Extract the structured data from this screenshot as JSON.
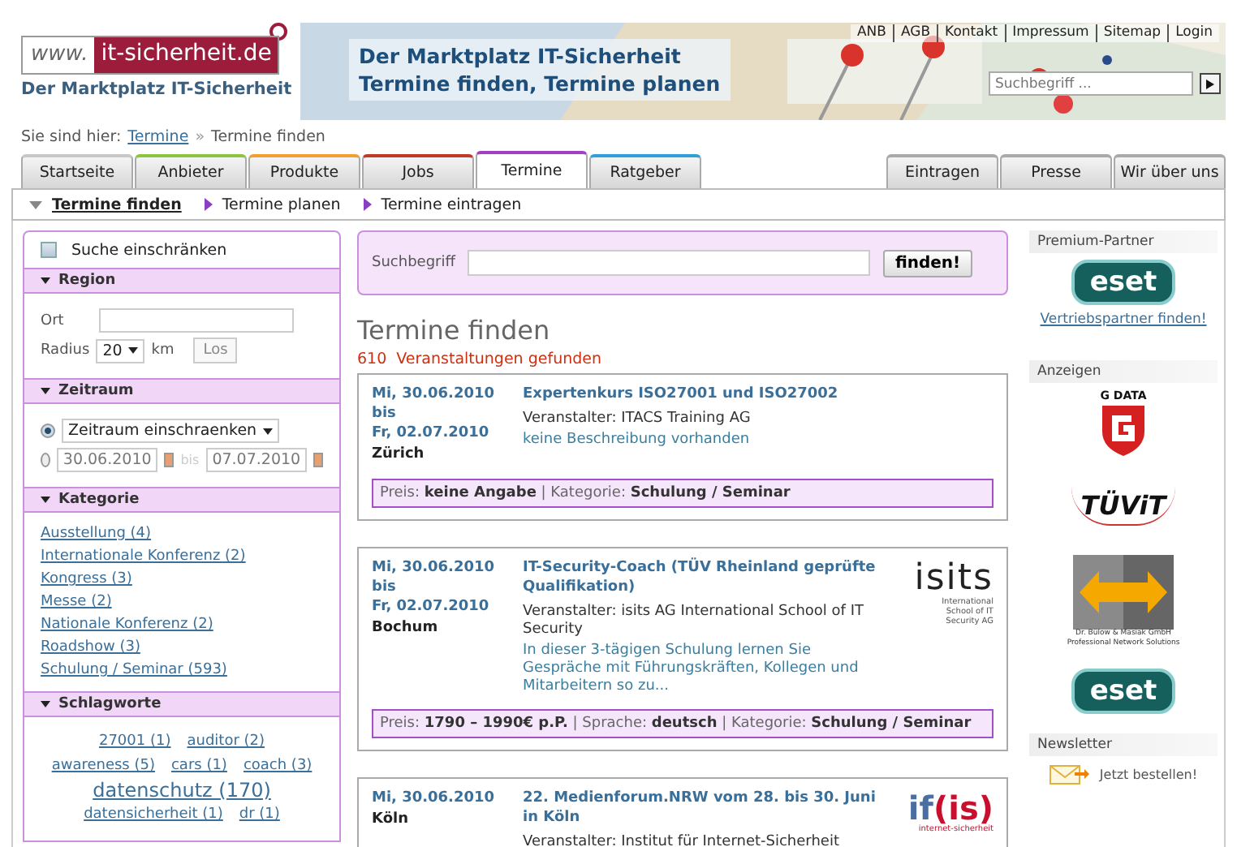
{
  "header": {
    "logo": {
      "prefix": "www.",
      "domain": "it-sicherheit.de"
    },
    "tagline": "Der Marktplatz IT-Sicherheit",
    "banner": {
      "lines": [
        "Der Marktplatz IT-Sicherheit",
        "Termine finden, Termine planen"
      ]
    },
    "top_links": [
      "ANB",
      "AGB",
      "Kontakt",
      "Impressum",
      "Sitemap",
      "Login"
    ],
    "search": {
      "placeholder": "Suchbegriff ..."
    }
  },
  "breadcrumb": {
    "label": "Sie sind hier:",
    "link": "Termine",
    "separator": "»",
    "current": "Termine finden"
  },
  "tabs_left": [
    {
      "label": "Startseite",
      "color": "#c8c8c8",
      "selected": false
    },
    {
      "label": "Anbieter",
      "color": "#8cc63f",
      "selected": false
    },
    {
      "label": "Produkte",
      "color": "#f0a030",
      "selected": false
    },
    {
      "label": "Jobs",
      "color": "#c0392b",
      "selected": false
    },
    {
      "label": "Termine",
      "color": "#a040c8",
      "selected": true
    },
    {
      "label": "Ratgeber",
      "color": "#30a0d8",
      "selected": false
    }
  ],
  "tabs_right": [
    {
      "label": "Eintragen",
      "selected": false
    },
    {
      "label": "Presse",
      "selected": false
    },
    {
      "label": "Wir über uns",
      "selected": false
    }
  ],
  "subnav": [
    {
      "label": "Termine finden",
      "selected": true
    },
    {
      "label": "Termine planen",
      "selected": false
    },
    {
      "label": "Termine eintragen",
      "selected": false
    }
  ],
  "sidebar": {
    "restrict": {
      "label": "Suche einschränken",
      "checked": false
    },
    "region": {
      "title": "Region",
      "ort_label": "Ort",
      "radius_label": "Radius",
      "radius": "20",
      "unit": "km",
      "button": "Los"
    },
    "zeitraum": {
      "title": "Zeitraum",
      "options": [
        {
          "kind": "dropdown",
          "selected": true,
          "value": "Zeitraum einschraenken"
        },
        {
          "kind": "dates",
          "selected": false,
          "from": "30.06.2010",
          "sep": "bis",
          "to": "07.07.2010"
        }
      ]
    },
    "kategorie": {
      "title": "Kategorie",
      "items": [
        "Ausstellung (4)",
        "Internationale Konferenz (2)",
        "Kongress (3)",
        "Messe (2)",
        "Nationale Konferenz (2)",
        "Roadshow (3)",
        "Schulung / Seminar (593)"
      ]
    },
    "schlagworte": {
      "title": "Schlagworte",
      "rows": [
        [
          {
            "text": "27001 (1)",
            "large": false
          },
          {
            "text": "auditor (2)",
            "large": false
          }
        ],
        [
          {
            "text": "awareness (5)",
            "large": false
          },
          {
            "text": "cars (1)",
            "large": false
          },
          {
            "text": "coach (3)",
            "large": false
          }
        ],
        [
          {
            "text": "datenschutz (170)",
            "large": true
          }
        ],
        [
          {
            "text": "datensicherheit (1)",
            "large": false
          },
          {
            "text": "dr (1)",
            "large": false
          }
        ]
      ]
    }
  },
  "main": {
    "search": {
      "label": "Suchbegriff",
      "button": "finden!"
    },
    "heading": "Termine finden",
    "count": "610",
    "count_label": "Veranstaltungen gefunden",
    "events": [
      {
        "date_from": "Mi, 30.06.2010",
        "bis": "bis",
        "date_to": "Fr, 02.07.2010",
        "city": "Zürich",
        "title": "Expertenkurs ISO27001 und ISO27002",
        "organizer": "Veranstalter: ITACS Training AG",
        "description": "keine Beschreibung vorhanden",
        "meta": "Preis: **keine Angabe** | Kategorie: **Schulung / Seminar**"
      },
      {
        "date_from": "Mi, 30.06.2010",
        "bis": "bis",
        "date_to": "Fr, 02.07.2010",
        "city": "Bochum",
        "title": "IT-Security-Coach (TÜV Rheinland geprüfte Qualifikation)",
        "organizer": "Veranstalter: isits AG International School of IT Security",
        "description": "In dieser 3-tägigen Schulung lernen Sie Gespräche mit Führungskräften, Kollegen und Mitarbeitern so zu...",
        "meta": "Preis: **1790 – 1990€ p.P.** | Sprache: **deutsch** | Kategorie: **Schulung / Seminar**",
        "logo": {
          "kind": "isits",
          "parts": [
            "isits"
          ],
          "sub": "International School of IT Security AG"
        }
      },
      {
        "date_from": "Mi, 30.06.2010",
        "city": "Köln",
        "title": "22. Medienforum.NRW vom 28. bis 30. Juni in Köln",
        "organizer": "Veranstalter: Institut für Internet-Sicherheit",
        "logo": {
          "kind": "ifis",
          "parts": [
            "if",
            "(is)"
          ],
          "sub": "internet-sicherheit"
        }
      }
    ]
  },
  "right": {
    "sections": [
      {
        "title": "Premium-Partner",
        "items": [
          {
            "kind": "eset",
            "text": "eset"
          },
          {
            "kind": "link",
            "text": "Vertriebspartner finden!"
          }
        ]
      },
      {
        "title": "Anzeigen",
        "items": [
          {
            "kind": "gdata",
            "text": "G DATA"
          },
          {
            "kind": "tuvit",
            "text": "TÜViT"
          },
          {
            "kind": "bulow",
            "lines": [
              "Dr. Bülow & Masiak GmbH",
              "Professional Network Solutions"
            ]
          },
          {
            "kind": "eset",
            "text": "eset"
          }
        ]
      },
      {
        "title": "Newsletter",
        "items": [
          {
            "kind": "newsletter",
            "text": "Jetzt bestellen!"
          }
        ]
      }
    ]
  }
}
